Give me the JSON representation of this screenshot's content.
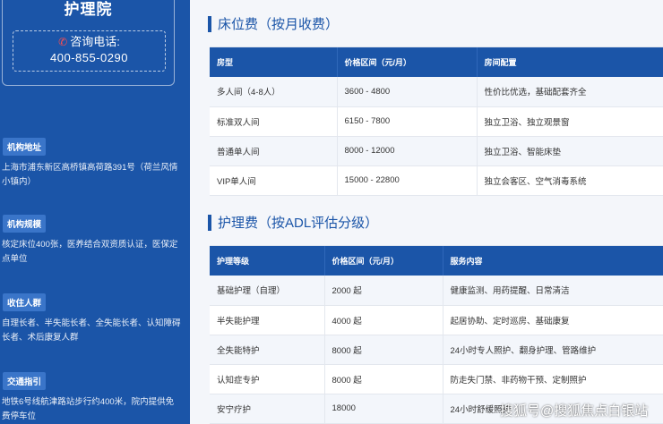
{
  "sidebar": {
    "brand": "护理院",
    "phone_label": "咨询电话:",
    "phone_number": "400-855-0290",
    "sections": [
      {
        "tag": "机构地址",
        "text": "上海市浦东新区高桥镇高荷路391号（荷兰风情小镇内）"
      },
      {
        "tag": "机构规模",
        "text": "核定床位400张，医养结合双资质认证，医保定点单位"
      },
      {
        "tag": "收住人群",
        "text": "自理长者、半失能长者、全失能长者、认知障碍长者、术后康复人群"
      },
      {
        "tag": "交通指引",
        "text": "地铁6号线航津路站步行约400米，院内提供免费停车位"
      }
    ]
  },
  "bed_section": {
    "title": "床位费（按月收费）",
    "headers": [
      "房型",
      "价格区间（元/月）",
      "房间配置"
    ],
    "rows": [
      [
        "多人间（4-8人）",
        "3600 - 4800",
        "性价比优选，基础配套齐全"
      ],
      [
        "标准双人间",
        "6150 - 7800",
        "独立卫浴、独立观景窗"
      ],
      [
        "普通单人间",
        "8000 - 12000",
        "独立卫浴、智能床垫"
      ],
      [
        "VIP单人间",
        "15000 - 22800",
        "独立会客区、空气消毒系统"
      ]
    ]
  },
  "care_section": {
    "title": "护理费（按ADL评估分级）",
    "headers": [
      "护理等级",
      "价格区间（元/月）",
      "服务内容"
    ],
    "rows": [
      [
        "基础护理（自理）",
        "2000 起",
        "健康监测、用药提醒、日常清洁"
      ],
      [
        "半失能护理",
        "4000 起",
        "起居协助、定时巡房、基础康复"
      ],
      [
        "全失能特护",
        "8000 起",
        "24小时专人照护、翻身护理、管路维护"
      ],
      [
        "认知症专护",
        "8000 起",
        "防走失门禁、非药物干预、定制照护"
      ],
      [
        "安宁疗护",
        "18000",
        "24小时舒缓照护"
      ]
    ]
  },
  "watermark": "搜狐号@搜狐焦点白银站",
  "colors": {
    "primary": "#1b55a8",
    "tag": "#3a75c9",
    "phone_icon": "#ff4d4d"
  },
  "icons": {
    "phone": "phone-icon"
  }
}
